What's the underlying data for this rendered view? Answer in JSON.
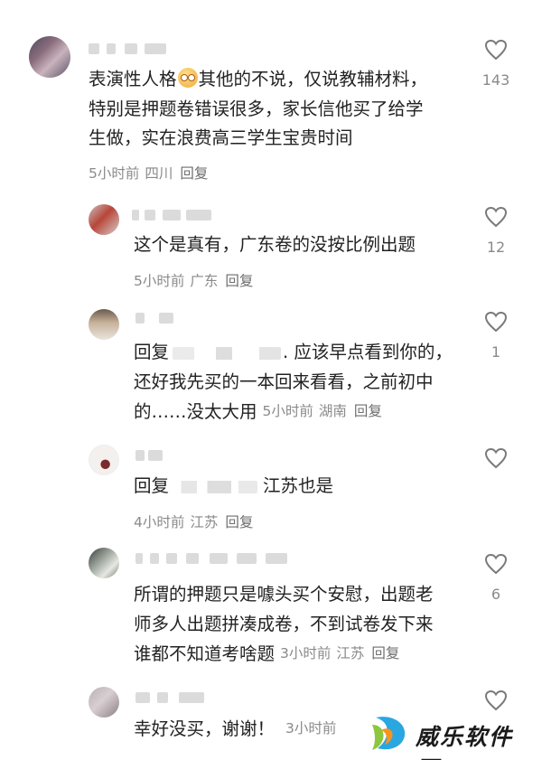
{
  "comments": [
    {
      "text_line1_a": "表演性人格",
      "text_line1_b": "其他的不说，仅说教辅材料，",
      "text_line2": "特别是押题卷错误很多，家长信他买了给学",
      "text_line3": "生做，实在浪费高三学生宝贵时间",
      "time": "5小时前",
      "location": "四川",
      "reply": "回复",
      "likes": "143",
      "emoji_icon": "laughing-sweat-emoji"
    },
    {
      "text_line1": "这个是真有，广东卷的没按比例出题",
      "time": "5小时前",
      "location": "广东",
      "reply": "回复",
      "likes": "12"
    },
    {
      "text_line1_prefix": "回复",
      "text_line1_suffix": ". 应该早点看到你的，",
      "text_line2": "还好我先买的一本回来看看，之前初中",
      "text_line3": "的……没太大用",
      "time": "5小时前",
      "location": "湖南",
      "reply": "回复",
      "likes": "1"
    },
    {
      "text_line1_prefix": "回复",
      "text_line1_suffix": "江苏也是",
      "time": "4小时前",
      "location": "江苏",
      "reply": "回复",
      "likes": ""
    },
    {
      "text_line1": "所谓的押题只是噱头买个安慰，出题老",
      "text_line2": "师多人出题拼凑成卷，不到试卷发下来",
      "text_line3": "谁都不知道考啥题",
      "time": "3小时前",
      "location": "江苏",
      "reply": "回复",
      "likes": "6"
    },
    {
      "text_line1": "幸好没买，谢谢！",
      "time": "3小时前",
      "likes": ""
    }
  ],
  "watermark": {
    "text": "威乐软件园",
    "logo_icon": "colorful-d-logo",
    "colors": [
      "#2aa7e0",
      "#8dc63f",
      "#f7941d"
    ]
  },
  "icons": {
    "like": "heart-outline-icon"
  },
  "colors": {
    "text": "#222222",
    "meta": "#8a8a8a",
    "heart_stroke": "#7a7a7a"
  }
}
